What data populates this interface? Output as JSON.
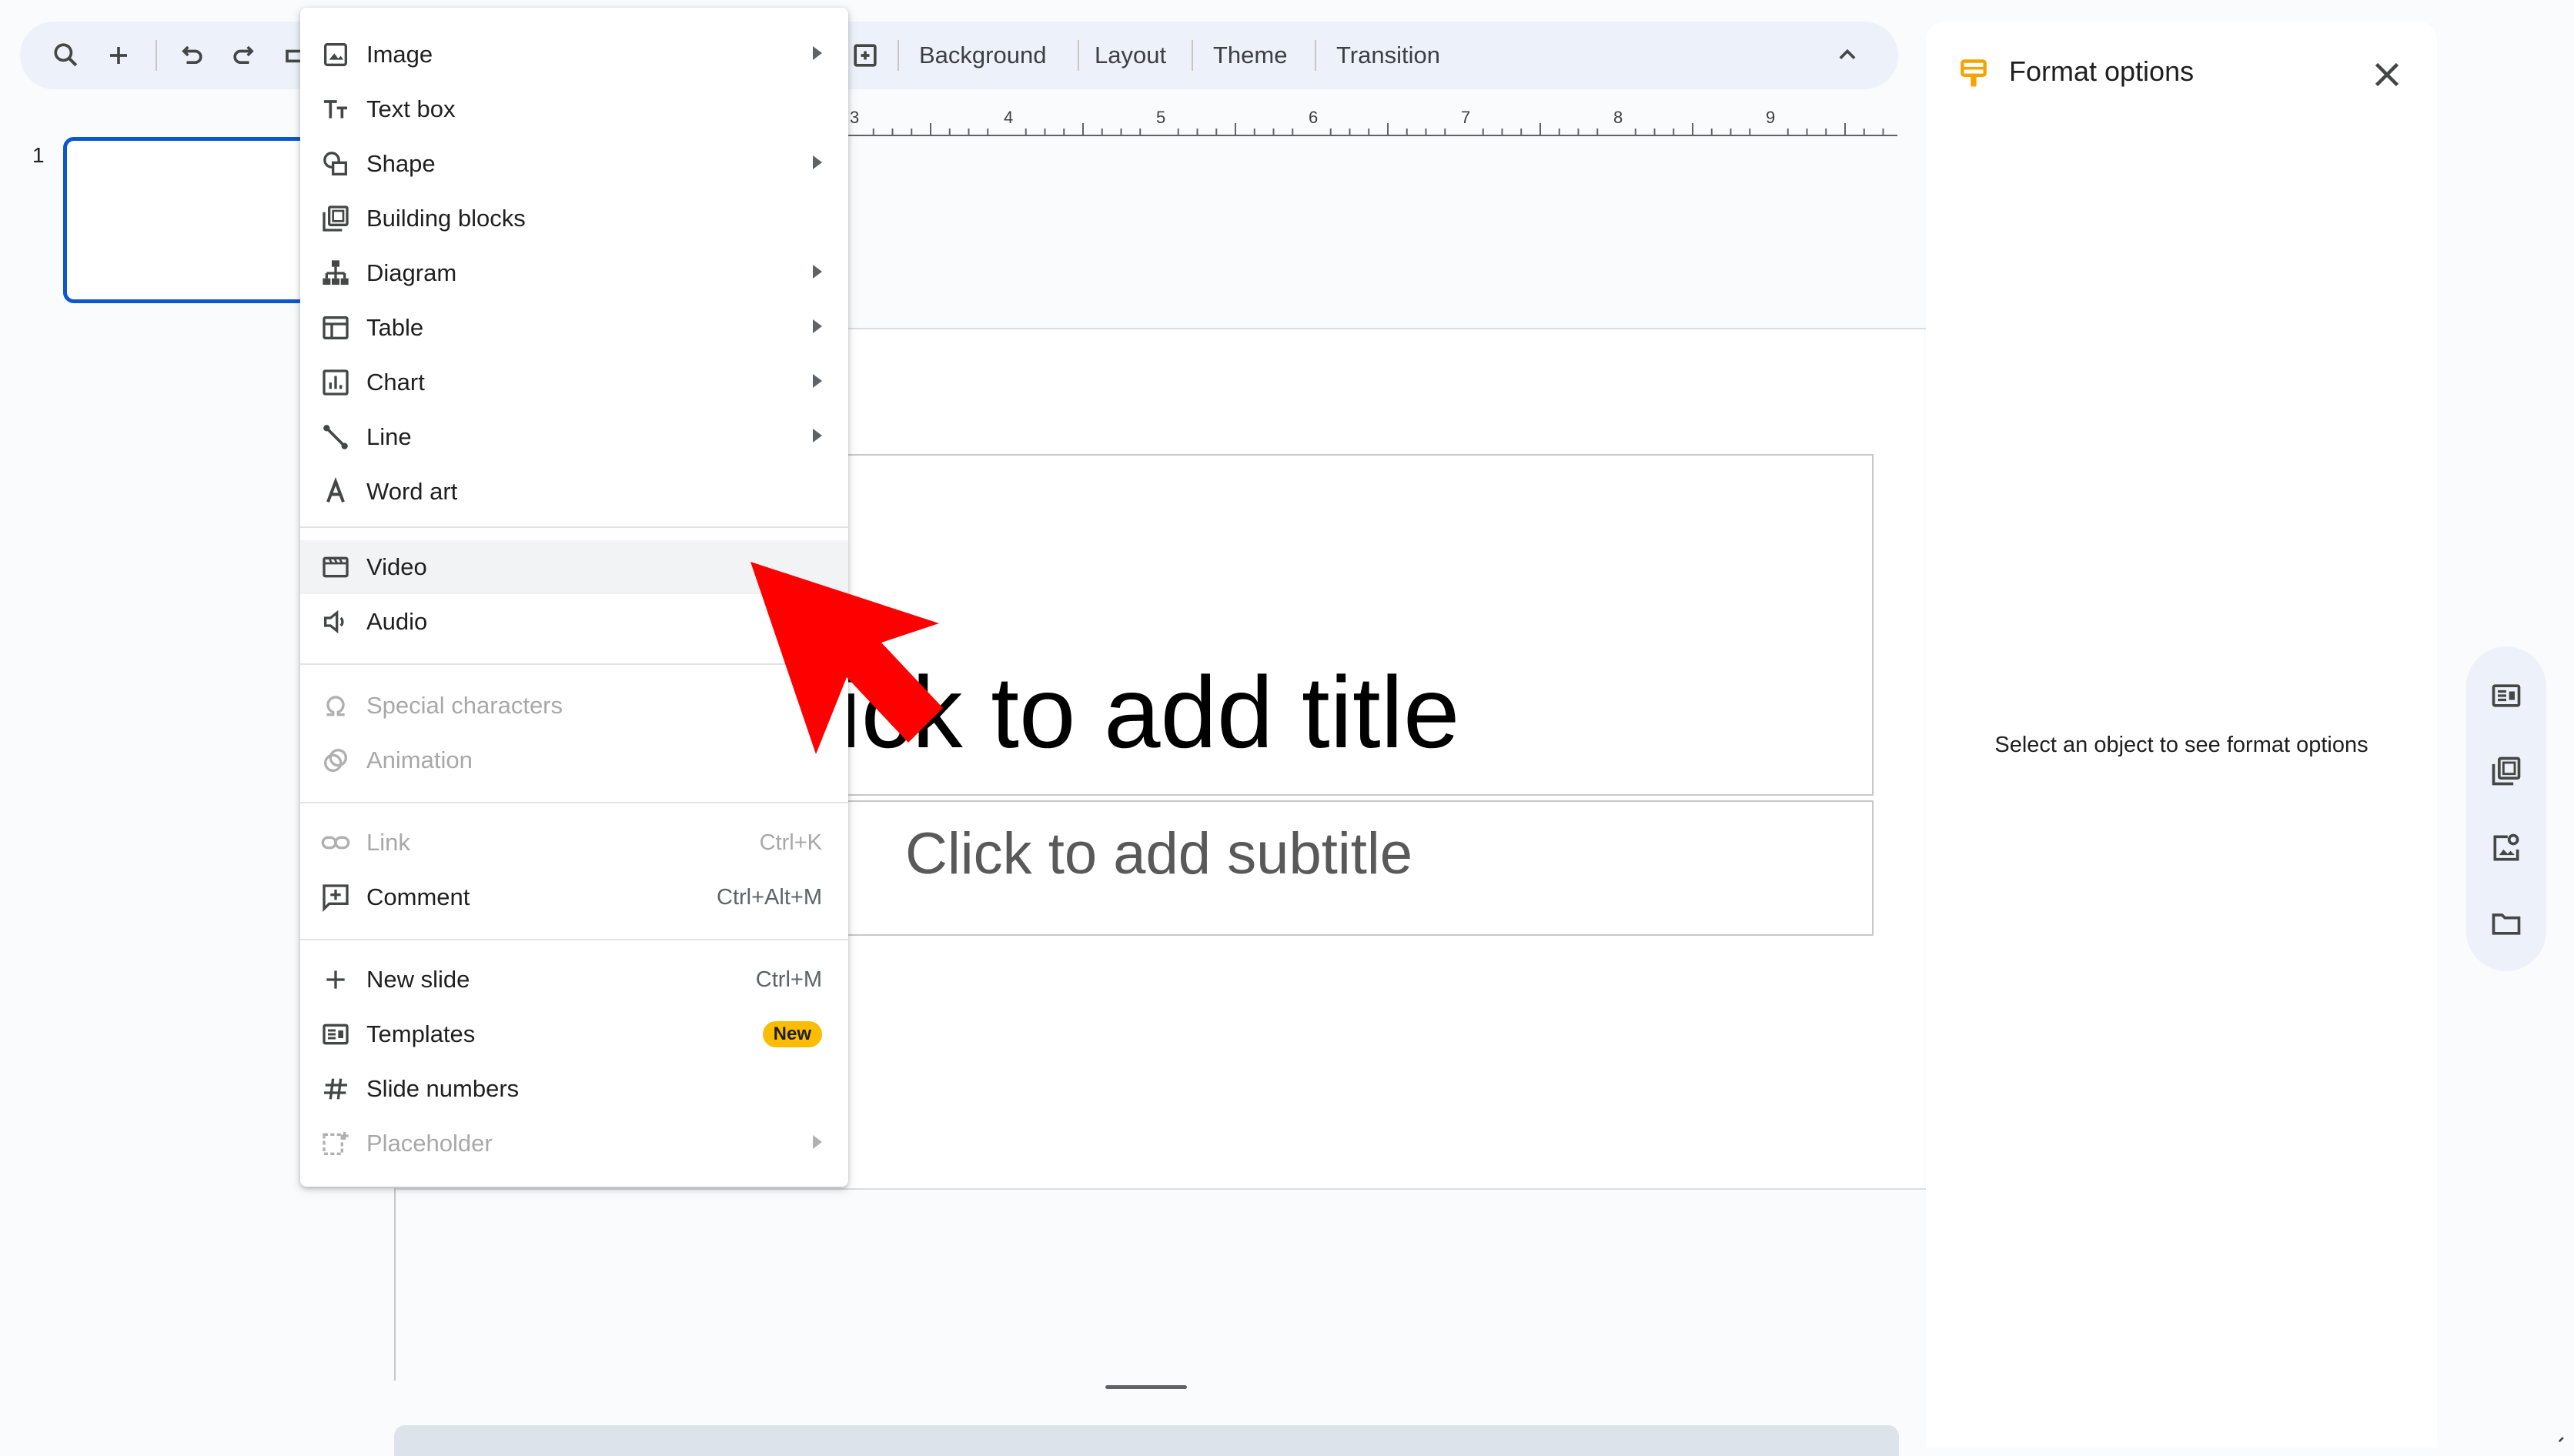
{
  "toolbar": {
    "tools": [
      "search-icon",
      "add-icon",
      "undo-icon",
      "redo-icon",
      "print-icon",
      "new-slide-icon"
    ],
    "buttons": {
      "background": "Background",
      "layout": "Layout",
      "theme": "Theme",
      "transition": "Transition"
    }
  },
  "ruler": {
    "numbers": [
      "3",
      "4",
      "5",
      "6",
      "7",
      "8",
      "9"
    ]
  },
  "filmstrip": {
    "slide_number": "1"
  },
  "slide": {
    "title_placeholder": "lick to add title",
    "subtitle_placeholder": "Click to add subtitle"
  },
  "insert_menu": {
    "items": [
      {
        "label": "Image",
        "icon": "image-icon",
        "submenu": true
      },
      {
        "label": "Text box",
        "icon": "text-box-icon"
      },
      {
        "label": "Shape",
        "icon": "shape-icon",
        "submenu": true
      },
      {
        "label": "Building blocks",
        "icon": "building-blocks-icon"
      },
      {
        "label": "Diagram",
        "icon": "diagram-icon",
        "submenu": true
      },
      {
        "label": "Table",
        "icon": "table-icon",
        "submenu": true
      },
      {
        "label": "Chart",
        "icon": "chart-icon",
        "submenu": true
      },
      {
        "label": "Line",
        "icon": "line-icon",
        "submenu": true
      },
      {
        "label": "Word art",
        "icon": "word-art-icon"
      },
      {
        "label": "Video",
        "icon": "video-icon",
        "highlighted": true
      },
      {
        "label": "Audio",
        "icon": "audio-icon"
      },
      {
        "label": "Special characters",
        "icon": "omega-icon",
        "disabled": true
      },
      {
        "label": "Animation",
        "icon": "animation-icon",
        "disabled": true
      },
      {
        "label": "Link",
        "icon": "link-icon",
        "shortcut": "Ctrl+K",
        "disabled": true
      },
      {
        "label": "Comment",
        "icon": "comment-icon",
        "shortcut": "Ctrl+Alt+M"
      },
      {
        "label": "New slide",
        "icon": "plus-icon",
        "shortcut": "Ctrl+M"
      },
      {
        "label": "Templates",
        "icon": "templates-icon",
        "badge": "New"
      },
      {
        "label": "Slide numbers",
        "icon": "hash-icon"
      },
      {
        "label": "Placeholder",
        "icon": "placeholder-icon",
        "submenu": true,
        "disabled": true
      }
    ]
  },
  "format_panel": {
    "title": "Format options",
    "message": "Select an object to see format options"
  },
  "side_rail": {
    "icons": [
      "templates-rail-icon",
      "building-blocks-rail-icon",
      "image-search-icon",
      "folder-icon"
    ]
  },
  "colors": {
    "accent": "#0b57d0",
    "badge": "#fbbc04",
    "pointer": "#ff0000",
    "panel_icon": "#fbbc04"
  }
}
